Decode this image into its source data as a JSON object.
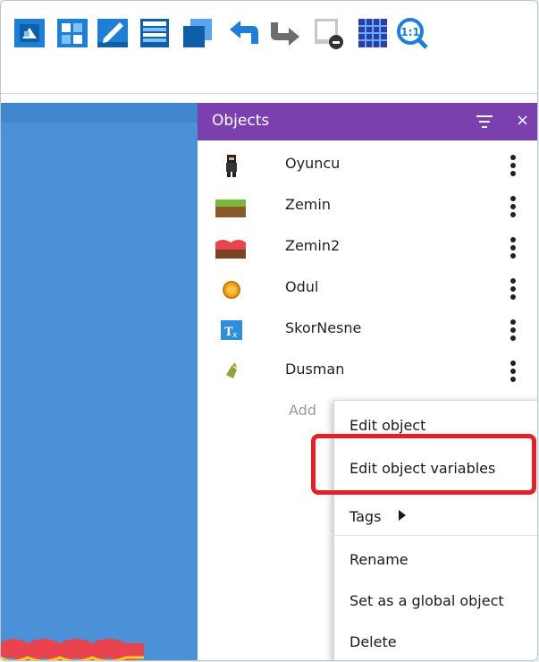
{
  "toolbar": {
    "icons": [
      "open-project-icon",
      "scene-editor-icon",
      "edit-properties-icon",
      "layers-icon",
      "objects-groups-icon",
      "undo-icon",
      "redo-icon",
      "preview-icon",
      "grid-icon",
      "zoom-reset-icon"
    ],
    "zoom_reset_label": "1:1"
  },
  "panel": {
    "title": "Objects",
    "objects": [
      {
        "name": "Oyuncu"
      },
      {
        "name": "Zemin"
      },
      {
        "name": "Zemin2"
      },
      {
        "name": "Odul"
      },
      {
        "name": "SkorNesne"
      },
      {
        "name": "Dusman"
      }
    ],
    "add_label": "Add"
  },
  "context_menu": {
    "items": [
      {
        "label": "Edit object"
      },
      {
        "label": "Edit object variables"
      },
      {
        "label": "Tags"
      },
      {
        "label": "Rename"
      },
      {
        "label": "Set as a global object"
      },
      {
        "label": "Delete"
      }
    ]
  },
  "colors": {
    "panel_header": "#7b3fb0",
    "scene_background": "#4a91d8",
    "highlight_border": "#e32027",
    "toolbar_icon_blue": "#1e7fd6"
  }
}
